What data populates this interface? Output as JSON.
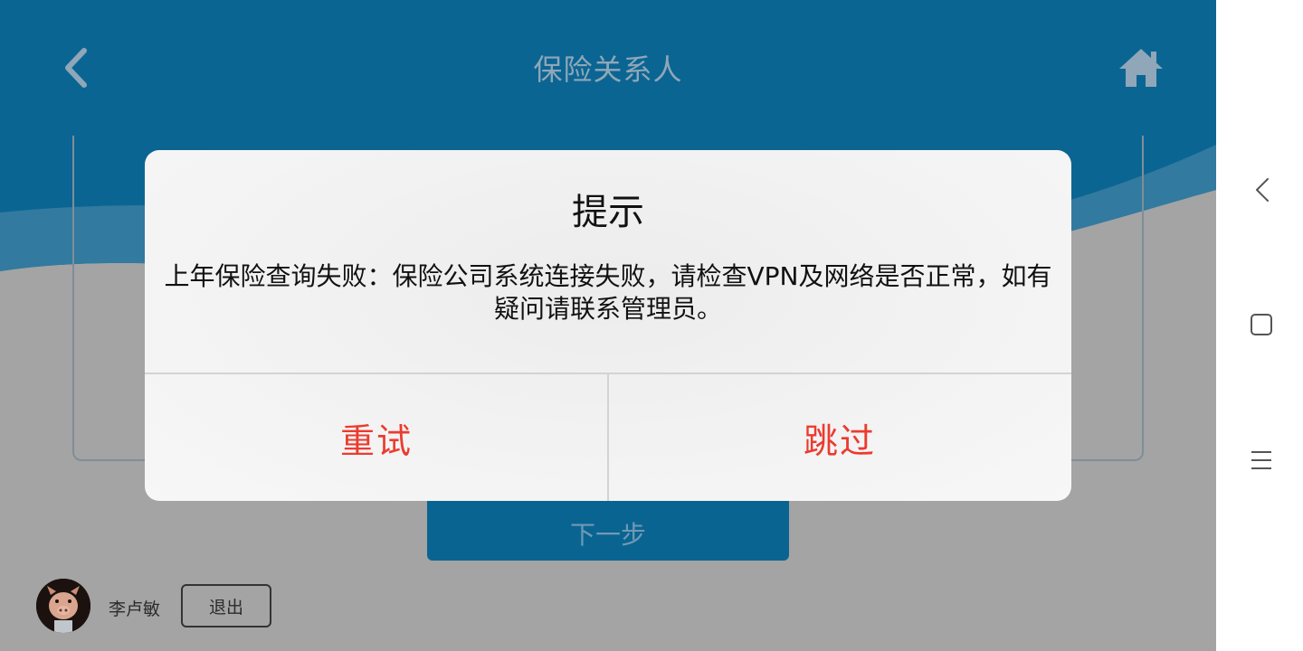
{
  "header": {
    "title": "保险关系人",
    "back_icon": "chevron-left-icon",
    "home_icon": "home-icon"
  },
  "main": {
    "next_button": "下一步"
  },
  "footer": {
    "user_name": "李卢敏",
    "logout_button": "退出"
  },
  "dialog": {
    "title": "提示",
    "message": "上年保险查询失败：保险公司系统连接失败，请检查VPN及网络是否正常，如有疑问请联系管理员。",
    "retry_button": "重试",
    "skip_button": "跳过"
  },
  "system_nav": {
    "back_icon": "triangle-back-icon",
    "home_icon": "square-home-icon",
    "menu_icon": "menu-icon"
  },
  "colors": {
    "header_blue": "#0a6491",
    "dialog_button_red": "#ec3b2f",
    "overlay_gray": "#a4a4a4"
  }
}
